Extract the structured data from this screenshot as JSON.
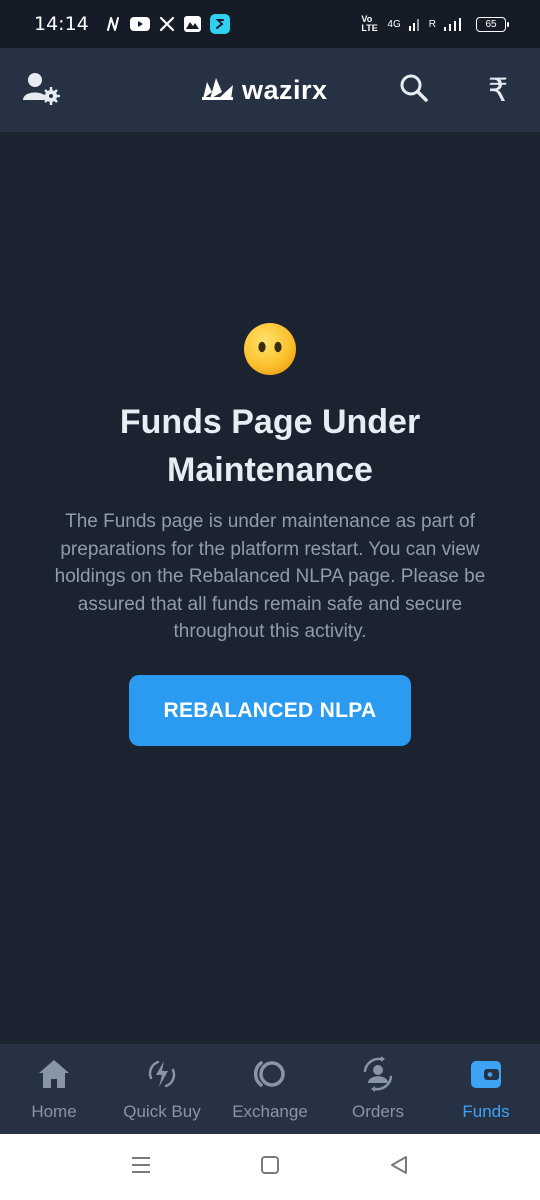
{
  "status_bar": {
    "time": "14:14",
    "apps": [
      "n-icon",
      "youtube-icon",
      "x-icon",
      "mountain-icon",
      "s-icon"
    ],
    "network_label": "4G",
    "volte_label": "Vo LTE",
    "roaming_label": "R",
    "battery": "65"
  },
  "header": {
    "brand": "wazirx",
    "icons": [
      "account-settings-icon",
      "search-icon",
      "rupee-icon"
    ],
    "rupee_symbol": "₹"
  },
  "main": {
    "emoji": "face-without-mouth-emoji",
    "title": "Funds Page Under Maintenance",
    "description": "The Funds page is under maintenance as part of preparations for the platform restart. You can view holdings on the Rebalanced NLPA page. Please be assured that all funds remain safe and secure throughout this activity.",
    "button_label": "REBALANCED NLPA"
  },
  "bottom_nav": {
    "items": [
      {
        "label": "Home",
        "icon": "home-icon"
      },
      {
        "label": "Quick Buy",
        "icon": "quick-buy-icon"
      },
      {
        "label": "Exchange",
        "icon": "exchange-icon"
      },
      {
        "label": "Orders",
        "icon": "orders-icon"
      },
      {
        "label": "Funds",
        "icon": "wallet-icon"
      }
    ],
    "active": "Funds"
  },
  "colors": {
    "background": "#1b2330",
    "header": "#263244",
    "accent": "#2a9bf0",
    "active_nav": "#3ea3f5",
    "inactive_nav": "#8795a6"
  }
}
